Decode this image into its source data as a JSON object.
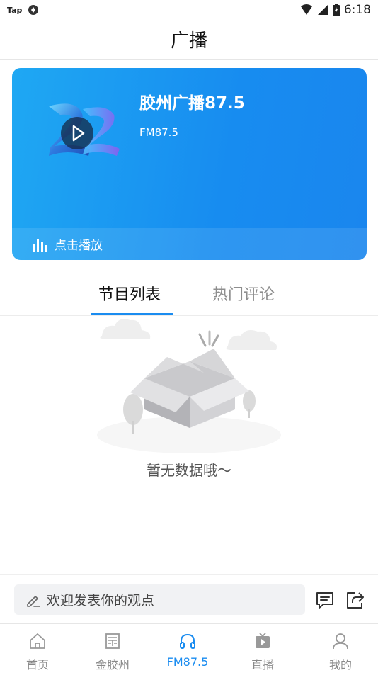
{
  "status_bar": {
    "carrier": "Tap",
    "time": "6:18"
  },
  "header": {
    "title": "广播"
  },
  "player": {
    "station_name": "胶州广播87.5",
    "frequency": "FM87.5",
    "play_label": "点击播放"
  },
  "tabs": [
    {
      "label": "节目列表",
      "active": true
    },
    {
      "label": "热门评论",
      "active": false
    }
  ],
  "empty_state": {
    "message": "暂无数据哦～"
  },
  "comment_bar": {
    "placeholder": "欢迎发表你的观点"
  },
  "bottom_nav": [
    {
      "label": "首页",
      "icon": "home-icon",
      "active": false
    },
    {
      "label": "金胶州",
      "icon": "newspaper-icon",
      "active": false
    },
    {
      "label": "FM87.5",
      "icon": "headphones-icon",
      "active": true
    },
    {
      "label": "直播",
      "icon": "tv-play-icon",
      "active": false
    },
    {
      "label": "我的",
      "icon": "user-icon",
      "active": false
    }
  ],
  "colors": {
    "accent": "#1a8cf0",
    "card_start": "#1fa8f3",
    "card_end": "#1a86ee"
  }
}
